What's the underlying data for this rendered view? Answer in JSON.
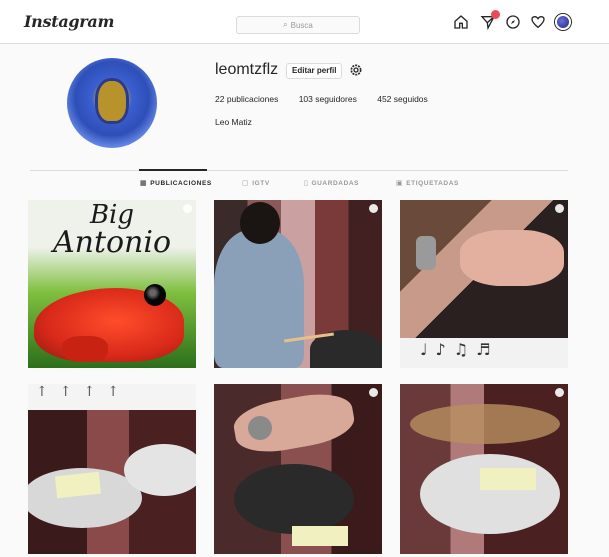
{
  "nav": {
    "logo": "Instagram",
    "search_placeholder": "Busca",
    "icons": [
      "home-icon",
      "direct-icon",
      "explore-icon",
      "activity-icon",
      "profile-avatar"
    ],
    "badge_color": "#ed4956"
  },
  "profile": {
    "username": "leomtzflz",
    "edit_label": "Editar perfil",
    "posts": "22 publicaciones",
    "followers": "103 seguidores",
    "following": "452 seguidos",
    "full_name": "Leo Matiz"
  },
  "tabs": [
    {
      "label": "PUBLICACIONES",
      "icon": "grid-icon",
      "active": true
    },
    {
      "label": "IGTV",
      "icon": "igtv-icon",
      "active": false
    },
    {
      "label": "GUARDADAS",
      "icon": "bookmark-icon",
      "active": false
    },
    {
      "label": "ETIQUETADAS",
      "icon": "tag-icon",
      "active": false
    }
  ],
  "posts": {
    "p1_line1": "Big",
    "p1_line2": "Antonio",
    "p3_notes": "♩♪♫♬",
    "p4_notes": "↑↑↑↑"
  }
}
